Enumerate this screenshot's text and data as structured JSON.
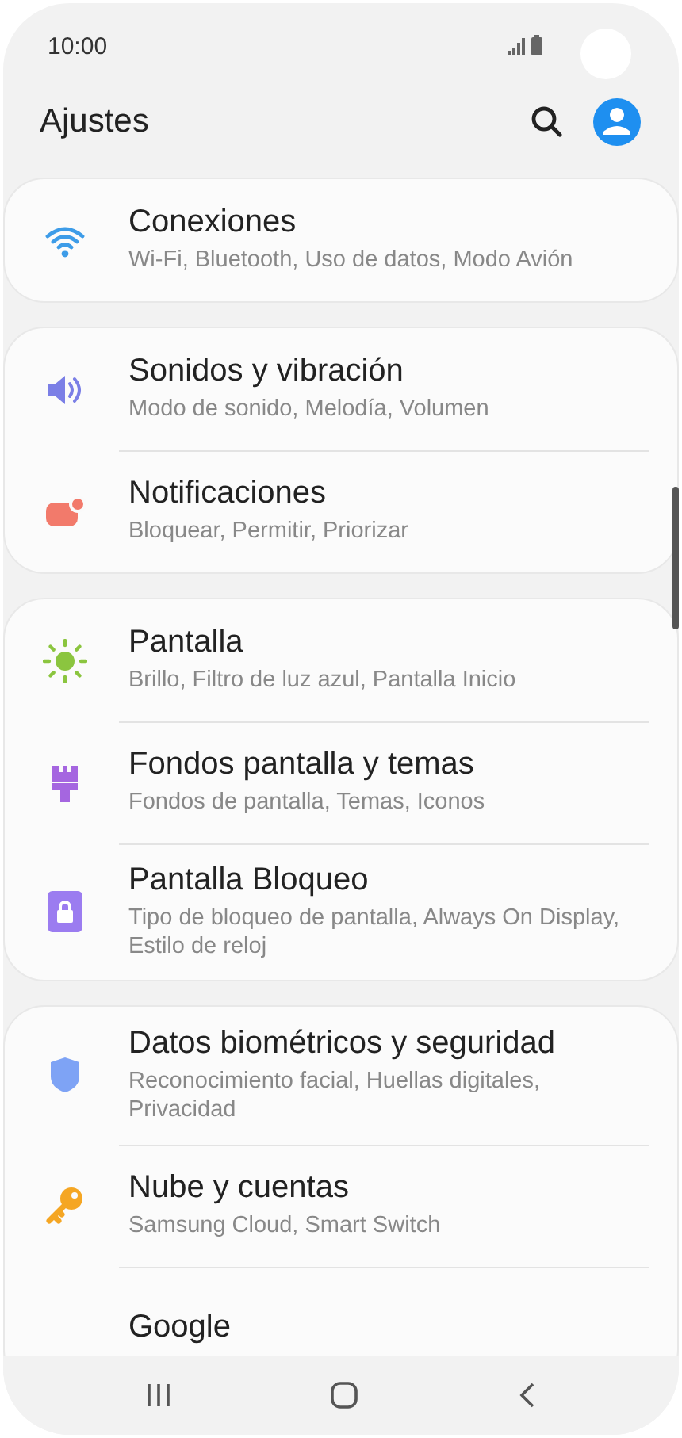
{
  "status_bar": {
    "time": "10:00"
  },
  "header": {
    "title": "Ajustes"
  },
  "groups": [
    {
      "items": [
        {
          "title": "Conexiones",
          "subtitle": "Wi-Fi, Bluetooth, Uso de datos, Modo Avión"
        }
      ]
    },
    {
      "items": [
        {
          "title": "Sonidos y vibración",
          "subtitle": "Modo de sonido, Melodía, Volumen"
        },
        {
          "title": "Notificaciones",
          "subtitle": "Bloquear, Permitir, Priorizar"
        }
      ]
    },
    {
      "items": [
        {
          "title": "Pantalla",
          "subtitle": "Brillo, Filtro de luz azul, Pantalla Inicio"
        },
        {
          "title": "Fondos pantalla y temas",
          "subtitle": "Fondos de pantalla, Temas, Iconos"
        },
        {
          "title": "Pantalla Bloqueo",
          "subtitle": "Tipo de bloqueo de pantalla, Always On Display, Estilo de reloj"
        }
      ]
    },
    {
      "items": [
        {
          "title": "Datos biométricos y seguridad",
          "subtitle": "Reconocimiento facial, Huellas digitales, Privacidad"
        },
        {
          "title": "Nube y cuentas",
          "subtitle": "Samsung Cloud, Smart Switch"
        },
        {
          "title": "Google"
        }
      ]
    }
  ]
}
